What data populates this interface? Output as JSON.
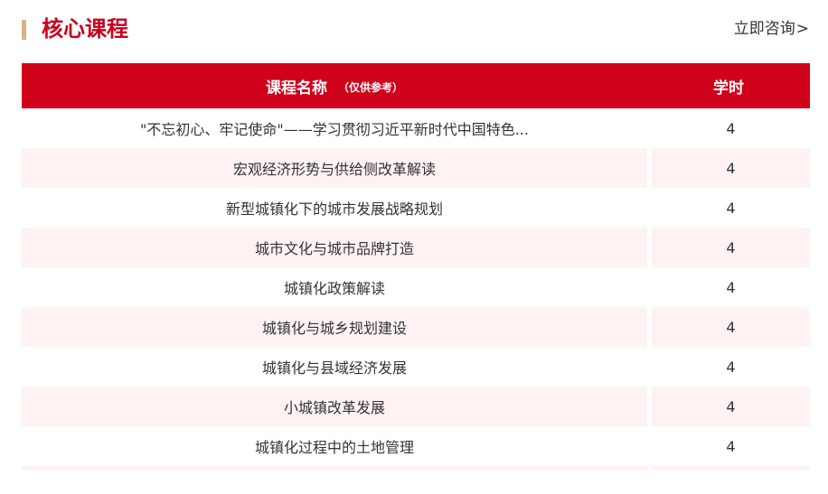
{
  "section": {
    "title": "核心课程",
    "consult_label": "立即咨询",
    "consult_arrow": ">"
  },
  "table": {
    "header_name": "课程名称",
    "header_note": "（仅供参考）",
    "header_hours": "学时",
    "rows": [
      {
        "name": "\"不忘初心、牢记使命\"——学习贯彻习近平新时代中国特色...",
        "hours": "4"
      },
      {
        "name": "宏观经济形势与供给侧改革解读",
        "hours": "4"
      },
      {
        "name": "新型城镇化下的城市发展战略规划",
        "hours": "4"
      },
      {
        "name": "城市文化与城市品牌打造",
        "hours": "4"
      },
      {
        "name": "城镇化政策解读",
        "hours": "4"
      },
      {
        "name": "城镇化与城乡规划建设",
        "hours": "4"
      },
      {
        "name": "城镇化与县域经济发展",
        "hours": "4"
      },
      {
        "name": "小城镇改革发展",
        "hours": "4"
      },
      {
        "name": "城镇化过程中的土地管理",
        "hours": "4"
      }
    ]
  },
  "colors": {
    "brand_red": "#d0011b",
    "title_red": "#c8001e",
    "accent_gold": "#d4b483",
    "row_alt_bg": "#fff2f2"
  }
}
